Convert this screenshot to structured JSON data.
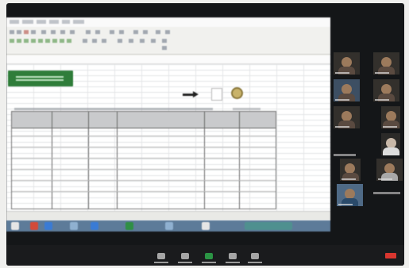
{
  "meeting": {
    "shared_window": "spreadsheet",
    "participants_count": 9
  },
  "colors": {
    "background": "#141618",
    "taskbar": "#5d7b99",
    "sheet_header": "#c9cacc",
    "green_box": "#2f7d3a",
    "end_button": "#d8362f",
    "video_on": "#2fb34f"
  },
  "icons": [
    "arrow-right-icon",
    "document-icon",
    "gear-icon",
    "mute-icon",
    "video-icon",
    "share-screen-icon",
    "participants-icon",
    "chat-icon",
    "end-call-icon"
  ]
}
